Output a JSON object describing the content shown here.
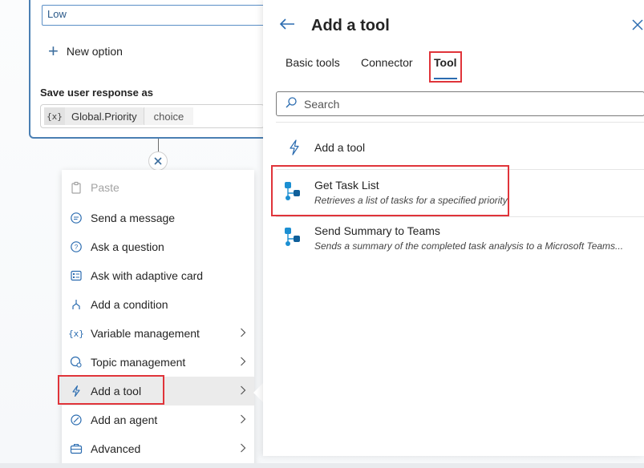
{
  "question_node": {
    "option_value": "Low",
    "new_option_label": "New option",
    "save_label": "Save user response as",
    "variable": {
      "icon": "{x}",
      "name": "Global.Priority",
      "type": "choice"
    }
  },
  "context_menu": {
    "items": [
      {
        "label": "Paste",
        "icon": "paste-icon",
        "disabled": true
      },
      {
        "label": "Send a message",
        "icon": "message-icon"
      },
      {
        "label": "Ask a question",
        "icon": "question-icon"
      },
      {
        "label": "Ask with adaptive card",
        "icon": "adaptive-card-icon"
      },
      {
        "label": "Add a condition",
        "icon": "condition-icon"
      },
      {
        "label": "Variable management",
        "icon": "variable-icon",
        "submenu": true
      },
      {
        "label": "Topic management",
        "icon": "topic-icon",
        "submenu": true
      },
      {
        "label": "Add a tool",
        "icon": "tool-icon",
        "submenu": true,
        "active": true
      },
      {
        "label": "Add an agent",
        "icon": "agent-icon",
        "submenu": true
      },
      {
        "label": "Advanced",
        "icon": "briefcase-icon",
        "submenu": true
      }
    ]
  },
  "panel": {
    "title": "Add a tool",
    "tabs": [
      {
        "label": "Basic tools"
      },
      {
        "label": "Connector"
      },
      {
        "label": "Tool",
        "selected": true
      }
    ],
    "search": {
      "placeholder": "Search",
      "value": ""
    },
    "add_tool_label": "Add a tool",
    "tools": [
      {
        "name": "Get Task List",
        "description": "Retrieves a list of tasks for a specified priority"
      },
      {
        "name": "Send Summary to Teams",
        "description": "Sends a summary of the completed task analysis to a Microsoft Teams..."
      }
    ]
  },
  "colors": {
    "accent": "#2b6cb0",
    "highlight": "#e0343a",
    "card_border": "#4a7fb3"
  }
}
